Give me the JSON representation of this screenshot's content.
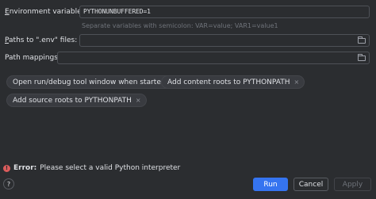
{
  "env": {
    "label_prefix": "E",
    "label_rest": "nvironment variables:",
    "value": "PYTHONUNBUFFERED=1",
    "hint": "Separate variables with semicolon: VAR=value; VAR1=value1"
  },
  "env_file": {
    "label_prefix": "P",
    "label_rest": "aths to \".env\" files:",
    "value": ""
  },
  "path_mappings": {
    "label": "Path mappings:",
    "value": ""
  },
  "chips": [
    {
      "label": "Open run/debug tool window when started",
      "close": "×"
    },
    {
      "label": "Add content roots to PYTHONPATH",
      "close": "×"
    },
    {
      "label": "Add source roots to PYTHONPATH",
      "close": "×"
    }
  ],
  "error": {
    "icon": "!",
    "title": "Error:",
    "message": "Please select a valid Python interpreter"
  },
  "footer": {
    "help": "?",
    "run": "Run",
    "cancel": "Cancel",
    "apply": "Apply"
  },
  "colors": {
    "background": "#2b2d30",
    "accent": "#3574f0",
    "error": "#db5c5c"
  }
}
